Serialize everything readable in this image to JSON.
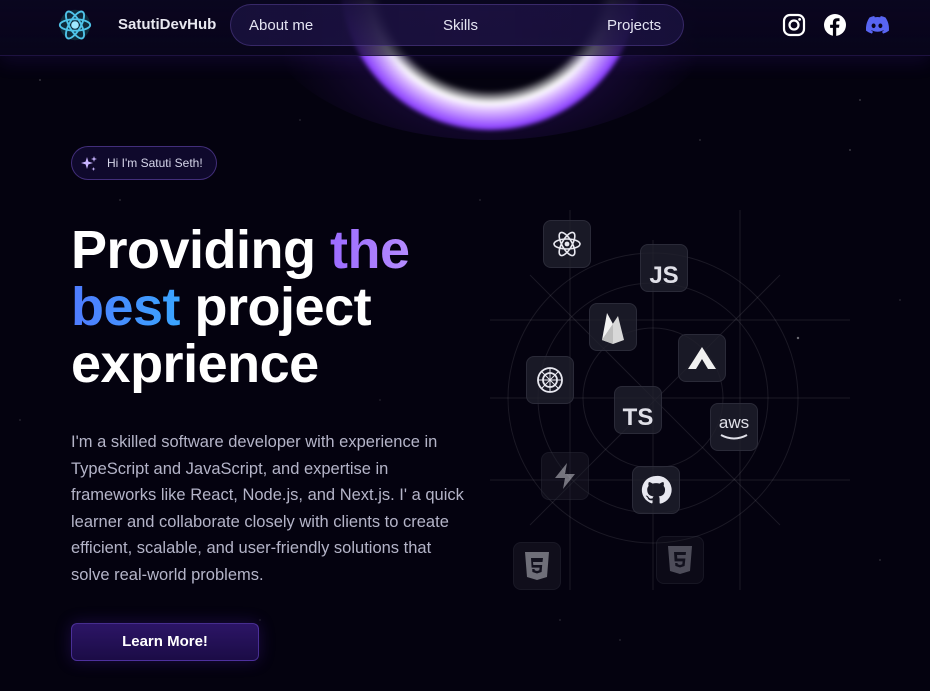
{
  "header": {
    "brand": "SatutiDevHub",
    "nav": [
      {
        "label": "About me"
      },
      {
        "label": "Skills"
      },
      {
        "label": "Projects"
      }
    ],
    "social_icons": [
      "instagram-icon",
      "facebook-icon",
      "discord-icon"
    ]
  },
  "hero": {
    "badge": "Hi I'm Satuti Seth!",
    "headline": {
      "part1": "Providing ",
      "part2": "the",
      "part3": "best",
      "part4": " project",
      "part5": "exprience"
    },
    "description": "I'm a skilled software developer with experience in TypeScript and JavaScript, and expertise in frameworks like React, Node.js, and Next.js. I' a quick learner and collaborate closely with clients to create efficient, scalable, and user-friendly solutions that solve real-world problems.",
    "cta": "Learn More!"
  },
  "skills": {
    "tiles": [
      {
        "icon": "react-icon"
      },
      {
        "icon": "javascript-icon",
        "text": "JS"
      },
      {
        "icon": "firebase-icon"
      },
      {
        "icon": "vercel-icon"
      },
      {
        "icon": "openai-icon"
      },
      {
        "icon": "typescript-icon",
        "text": "TS"
      },
      {
        "icon": "aws-icon",
        "text": "aws"
      },
      {
        "icon": "supabase-icon"
      },
      {
        "icon": "github-icon"
      },
      {
        "icon": "css3-icon"
      },
      {
        "icon": "html5-icon"
      }
    ]
  },
  "colors": {
    "background": "#04020f",
    "accent_purple": "#9b6bff",
    "accent_blue": "#3aa5ff",
    "discord": "#5865f2"
  }
}
